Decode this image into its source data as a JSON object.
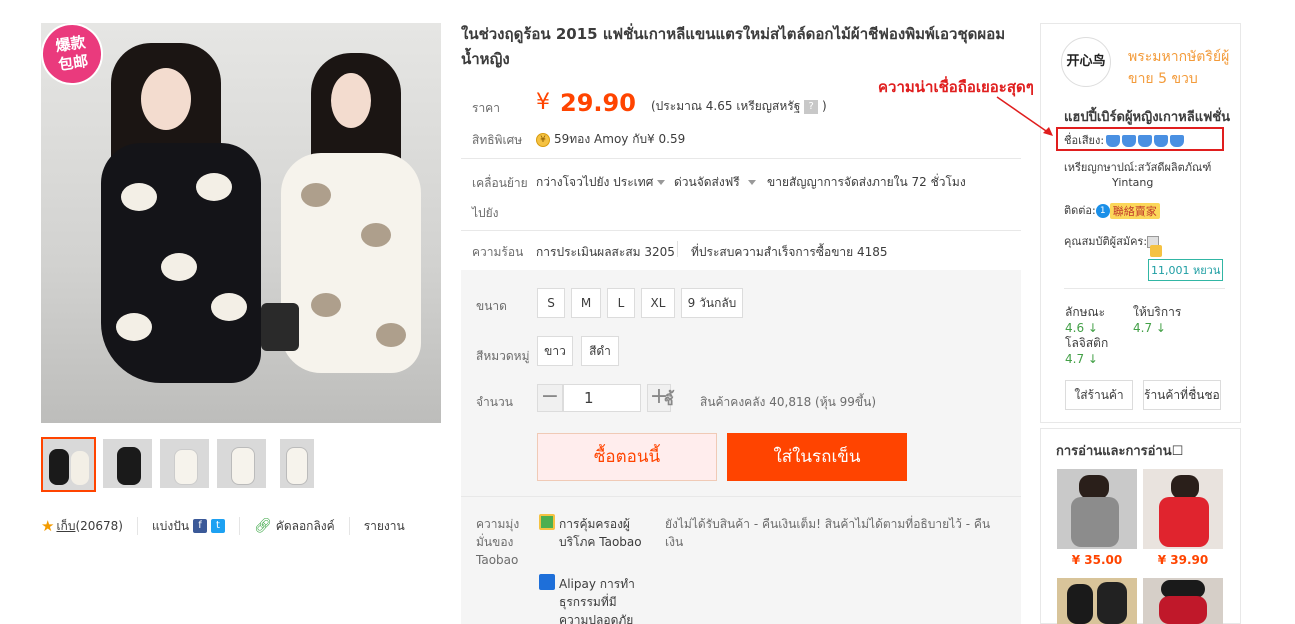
{
  "gallery": {
    "badge": "爆款\n包邮",
    "thumb_count": 5
  },
  "share": {
    "favorites": "(20678)",
    "favorites_label": "เก็บ",
    "share_label": "แบ่งปัน",
    "copy_link": "คัดลอกลิงค์",
    "report": "รายงาน"
  },
  "product": {
    "title": "ในช่วงฤดูร้อน 2015 แฟชั่นเกาหลีแขนแตรใหม่สไตล์ดอกไม้ผ้าชีฟองพิมพ์เอวชุดผอมน้ำหญิง",
    "price_label": "ราคา",
    "currency": "¥",
    "price": "29.90",
    "price_approx": "(ประมาณ 4.65 เหรียญสหรัฐ",
    "price_approx_end": ")",
    "privilege_label": "สิทธิพิเศษ",
    "privilege_text": "59ทอง Amoy กับ¥ 0.59",
    "shipping_label": "เคลื่อนย้าย",
    "shipping_label2": "ไปยัง",
    "ship_from": "กว่างโจวไปยัง ประเทศ",
    "ship_speed": "ด่วนจัดส่งฟรี",
    "ship_promise": "ขายสัญญาการจัดส่งภายใน 72 ชั่วโมง",
    "hot_label": "ความร้อน",
    "reviews": "การประเมินผลสะสม 3205",
    "sold": "ที่ประสบความสำเร็จการซื้อขาย 4185"
  },
  "sku": {
    "size_label": "ขนาด",
    "sizes": [
      "S",
      "M",
      "L",
      "XL",
      "9 วันกลับ"
    ],
    "color_label": "สีหมวดหมู่",
    "colors": [
      "ขาว",
      "สีดำ"
    ],
    "qty_label": "จำนวน",
    "qty_value": "1",
    "qty_unit": "ชิ้",
    "stock": "สินค้าคงคลัง 40,818 (หุ้น 99ขึ้น)",
    "buy_now": "ซื้อตอนนี้",
    "add_cart": "ใส่ในรถเข็น"
  },
  "promise": {
    "label": "ความมุ่งมั่นของ Taobao",
    "item1_title": "การคุ้มครองผู้บริโภค Taobao",
    "item1_desc": "ยังไม่ได้รับสินค้า - คืนเงินเต็ม! สินค้าไม่ได้ตามที่อธิบายไว้ - คืนเงิน",
    "item2_title": "Alipay การทำธุรกรรมที่มีความปลอดภัย"
  },
  "seller": {
    "logo_text": "开心鸟",
    "name": "พระมหากษัตริย์ผู้ขาย 5 ขวบ",
    "annotation": "ความน่าเชื่อถือเยอะสุดๆ",
    "shop_title": "แฮปปี้เบิร์ดผู้หญิงเกาหลีแฟชั่น",
    "reputation_label": "ชื่อเสียง:",
    "coin_label": "เหรียญกษาปณ์:สวัสดีผลิตภัณฑ์",
    "coin_name": "Yintang",
    "contact_label": "ติดต่อ:",
    "contact_badge": "聯絡賣家",
    "qual_label": "คุณสมบัติผู้สมัคร:",
    "deposit": "11,001 หยวน",
    "score_desc_label": "ลักษณะ",
    "score_desc": "4.6",
    "score_service_label": "ให้บริการ",
    "score_service": "4.7",
    "score_logistics_label": "โลจิสติก",
    "score_logistics": "4.7",
    "enter_shop": "ใส่ร้านค้า",
    "fav_shop": "ร้านค้าที่ชื่นชอบ"
  },
  "reco": {
    "title": "การอ่านและการอ่าน☐",
    "prices": [
      "¥ 35.00",
      "¥ 39.90"
    ]
  },
  "colors": {
    "accent": "#ff4400",
    "annotation": "#e01e1e",
    "score_green": "#43a047",
    "seller_orange": "#f39b3a"
  }
}
